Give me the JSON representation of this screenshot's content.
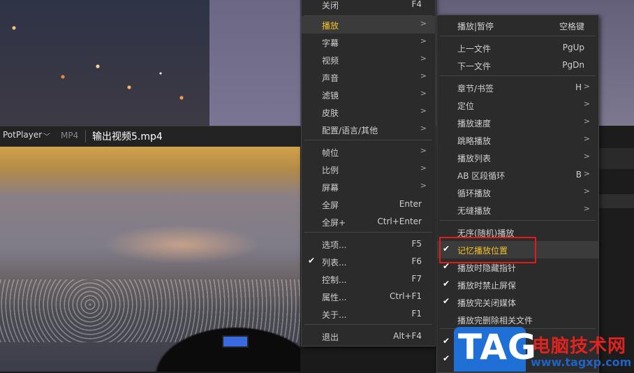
{
  "player": {
    "app_name": "PotPlayer",
    "format": "MP4",
    "filename": "输出视频5.mp4"
  },
  "main_menu": {
    "items": [
      {
        "label": "关闭",
        "key": "F4",
        "arrow": "",
        "check": false,
        "highlight": false
      },
      {
        "label": "播放",
        "key": "",
        "arrow": ">",
        "check": false,
        "highlight": true
      },
      {
        "label": "字幕",
        "key": "",
        "arrow": ">",
        "check": false,
        "highlight": false
      },
      {
        "label": "视频",
        "key": "",
        "arrow": ">",
        "check": false,
        "highlight": false
      },
      {
        "label": "声音",
        "key": "",
        "arrow": ">",
        "check": false,
        "highlight": false
      },
      {
        "label": "滤镜",
        "key": "",
        "arrow": ">",
        "check": false,
        "highlight": false
      },
      {
        "label": "皮肤",
        "key": "",
        "arrow": ">",
        "check": false,
        "highlight": false
      },
      {
        "label": "配置/语言/其他",
        "key": "",
        "arrow": ">",
        "check": false,
        "highlight": false
      },
      {
        "label": "帧位",
        "key": "",
        "arrow": ">",
        "check": false,
        "highlight": false
      },
      {
        "label": "比例",
        "key": "",
        "arrow": ">",
        "check": false,
        "highlight": false
      },
      {
        "label": "屏幕",
        "key": "",
        "arrow": ">",
        "check": false,
        "highlight": false
      },
      {
        "label": "全屏",
        "key": "Enter",
        "arrow": "",
        "check": false,
        "highlight": false
      },
      {
        "label": "全屏+",
        "key": "Ctrl+Enter",
        "arrow": "",
        "check": false,
        "highlight": false
      },
      {
        "label": "选项...",
        "key": "F5",
        "arrow": "",
        "check": false,
        "highlight": false
      },
      {
        "label": "列表...",
        "key": "F6",
        "arrow": "",
        "check": true,
        "highlight": false
      },
      {
        "label": "控制...",
        "key": "F7",
        "arrow": "",
        "check": false,
        "highlight": false
      },
      {
        "label": "属性...",
        "key": "Ctrl+F1",
        "arrow": "",
        "check": false,
        "highlight": false
      },
      {
        "label": "关于...",
        "key": "F1",
        "arrow": "",
        "check": false,
        "highlight": false
      },
      {
        "label": "退出",
        "key": "Alt+F4",
        "arrow": "",
        "check": false,
        "highlight": false
      }
    ]
  },
  "play_submenu": {
    "items": [
      {
        "label": "播放|暂停",
        "key": "空格键",
        "arrow": "",
        "check": false,
        "highlight": false
      },
      {
        "label": "上一文件",
        "key": "PgUp",
        "arrow": "",
        "check": false,
        "highlight": false
      },
      {
        "label": "下一文件",
        "key": "PgDn",
        "arrow": "",
        "check": false,
        "highlight": false
      },
      {
        "label": "章节/书签",
        "key": "H",
        "arrow": ">",
        "check": false,
        "highlight": false
      },
      {
        "label": "定位",
        "key": "",
        "arrow": ">",
        "check": false,
        "highlight": false
      },
      {
        "label": "播放速度",
        "key": "",
        "arrow": ">",
        "check": false,
        "highlight": false
      },
      {
        "label": "跳略播放",
        "key": "",
        "arrow": ">",
        "check": false,
        "highlight": false
      },
      {
        "label": "播放列表",
        "key": "",
        "arrow": ">",
        "check": false,
        "highlight": false
      },
      {
        "label": "AB 区段循环",
        "key": "B",
        "arrow": ">",
        "check": false,
        "highlight": false
      },
      {
        "label": "循环播放",
        "key": "",
        "arrow": ">",
        "check": false,
        "highlight": false
      },
      {
        "label": "无缝播放",
        "key": "",
        "arrow": ">",
        "check": false,
        "highlight": false
      },
      {
        "label": "无序(随机)播放",
        "key": "",
        "arrow": "",
        "check": false,
        "highlight": false
      },
      {
        "label": "记忆播放位置",
        "key": "",
        "arrow": "",
        "check": true,
        "highlight": true
      },
      {
        "label": "播放时隐藏指针",
        "key": "",
        "arrow": "",
        "check": true,
        "highlight": false
      },
      {
        "label": "播放时禁止屏保",
        "key": "",
        "arrow": "",
        "check": true,
        "highlight": false
      },
      {
        "label": "播放完关闭媒体",
        "key": "",
        "arrow": "",
        "check": true,
        "highlight": false
      },
      {
        "label": "播放完删除相关文件",
        "key": "",
        "arrow": "",
        "check": false,
        "highlight": false
      }
    ]
  },
  "watermark": {
    "tag": "TAG",
    "site_name": "电脑技术网",
    "url": "www.tagxp.com"
  },
  "colors": {
    "highlight_text": "#f3c12a",
    "annotation_box": "#e21c1c",
    "watermark_blue": "#1f6fd6",
    "watermark_red": "#e0231f"
  }
}
